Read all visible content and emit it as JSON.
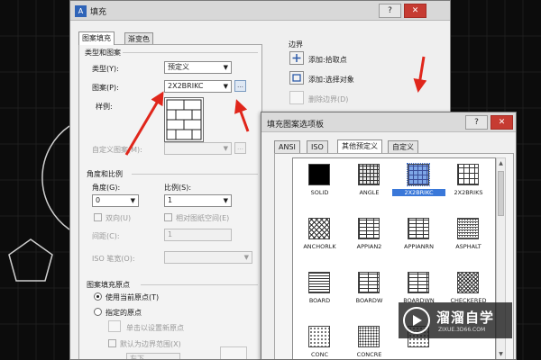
{
  "hatch_dialog": {
    "title": "填充",
    "help_btn": "?",
    "close_btn": "✕",
    "tabs": [
      "图案填充",
      "渐变色"
    ],
    "type_section": "类型和图案",
    "type_label": "类型(Y):",
    "type_value": "预定义",
    "pattern_label": "图案(P):",
    "pattern_value": "2X2BRIKC",
    "sample_label": "样例:",
    "custom_label": "自定义图案(M):",
    "angle_section": "角度和比例",
    "angle_label": "角度(G):",
    "angle_value": "0",
    "scale_label": "比例(S):",
    "scale_value": "1",
    "double_label": "双向(U)",
    "paper_label": "相对图纸空间(E)",
    "spacing_label": "间距(C):",
    "spacing_value": "1",
    "iso_label": "ISO 笔宽(O):",
    "origin_section": "图案填充原点",
    "use_current": "使用当前原点(T)",
    "specify_origin": "指定的原点",
    "click_set": "单击以设置新原点",
    "default_extent": "默认为边界范围(X)",
    "bottom_value": "左下",
    "boundary_section": "边界",
    "add_pick": "添加:拾取点",
    "add_select": "添加:选择对象",
    "remove_boundary": "删除边界(D)"
  },
  "palette": {
    "title": "填充图案选项板",
    "help_btn": "?",
    "close_btn": "✕",
    "tabs": [
      "ANSI",
      "ISO",
      "其他预定义",
      "自定义"
    ],
    "active_tab": 2,
    "patterns": [
      {
        "name": "SOLID",
        "swatch": "p-solid"
      },
      {
        "name": "ANGLE",
        "swatch": "p-angle"
      },
      {
        "name": "2X2BRIKC",
        "swatch": "p-2x2brick",
        "selected": true
      },
      {
        "name": "2X2BRIKS",
        "swatch": "p-2x2briks"
      },
      {
        "name": "ANCHORLK",
        "swatch": "p-anchor"
      },
      {
        "name": "APPIAN2",
        "swatch": "p-brick"
      },
      {
        "name": "APPIANRN",
        "swatch": "p-brick"
      },
      {
        "name": "ASPHALT",
        "swatch": "p-asphalt"
      },
      {
        "name": "BOARD",
        "swatch": "p-board"
      },
      {
        "name": "BOARDW",
        "swatch": "p-boardw"
      },
      {
        "name": "BOARDWN",
        "swatch": "p-boardw"
      },
      {
        "name": "CHECKERED",
        "swatch": "p-checker"
      },
      {
        "name": "CONC",
        "swatch": "p-conc"
      },
      {
        "name": "CONCRE",
        "swatch": "p-concre"
      },
      {
        "name": "",
        "swatch": "p-conc"
      }
    ]
  },
  "watermark": {
    "name": "溜溜自学",
    "url": "ZIXUE.3D66.COM"
  },
  "colors": {
    "selection": "#3a78d9",
    "annotation_arrow": "#e0261b",
    "cad_background": "#0c0c0c"
  }
}
